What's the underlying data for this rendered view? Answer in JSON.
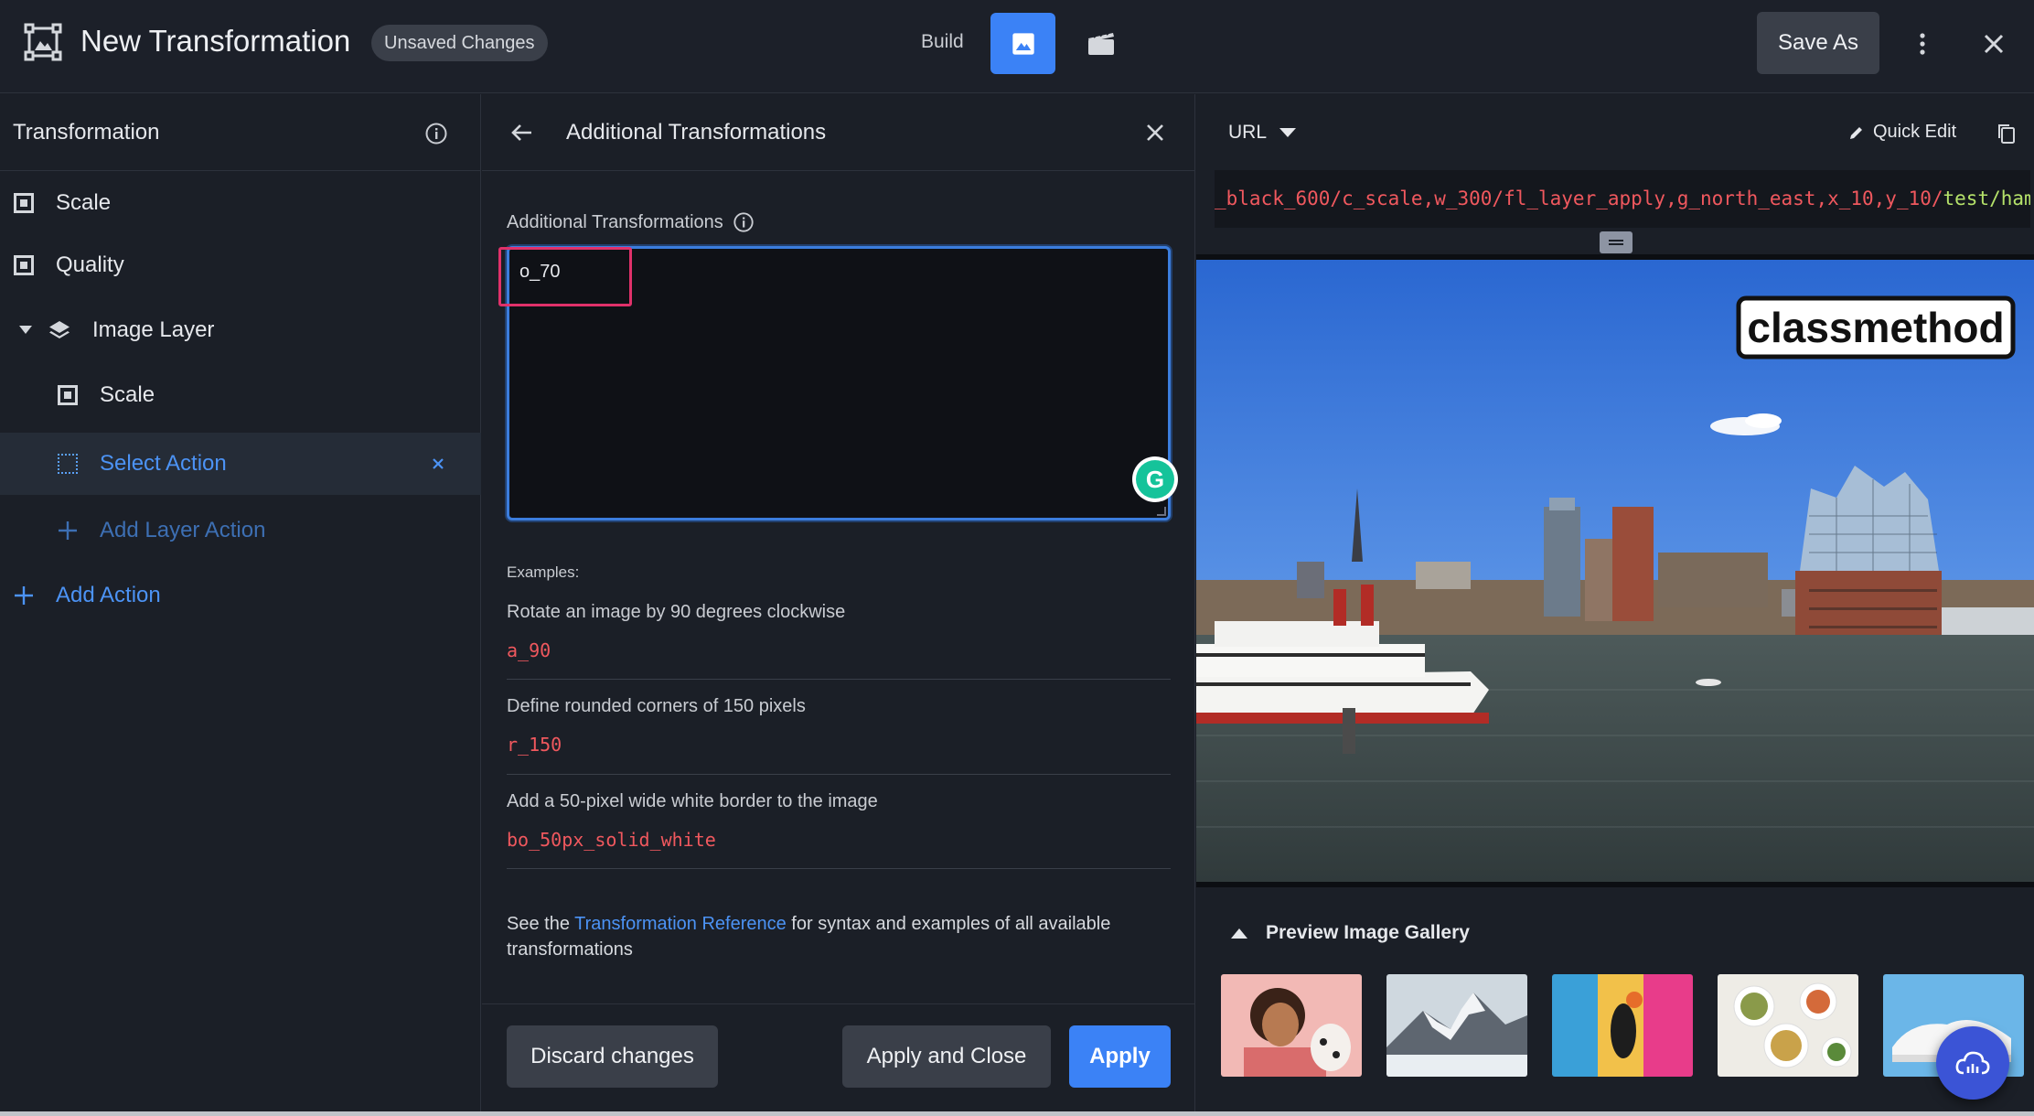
{
  "topbar": {
    "title": "New Transformation",
    "badge": "Unsaved Changes",
    "build_label": "Build",
    "save_as": "Save As"
  },
  "left": {
    "header": "Transformation",
    "items": [
      {
        "label": "Scale"
      },
      {
        "label": "Quality"
      },
      {
        "label": "Image Layer"
      },
      {
        "label": "Scale"
      },
      {
        "label": "Select Action"
      },
      {
        "label": "Add Layer Action"
      },
      {
        "label": "Add Action"
      }
    ]
  },
  "middle": {
    "header": "Additional Transformations",
    "field_label": "Additional Transformations",
    "field_value": "o_70",
    "examples_label": "Examples:",
    "examples": [
      {
        "desc": "Rotate an image by 90 degrees clockwise",
        "code": "a_90"
      },
      {
        "desc": "Define rounded corners of 150 pixels",
        "code": "r_150"
      },
      {
        "desc": "Add a 50-pixel wide white border to the image",
        "code": "bo_50px_solid_white"
      }
    ],
    "ref_prefix": "See the ",
    "ref_link": "Transformation Reference",
    "ref_suffix": " for syntax and examples of all available transformations",
    "buttons": {
      "discard": "Discard changes",
      "apply_close": "Apply and Close",
      "apply": "Apply"
    }
  },
  "right": {
    "url_mode": "URL",
    "quick_edit": "Quick Edit",
    "url_red": "_black_600/c_scale,w_300/fl_layer_apply,g_north_east,x_10,y_10/",
    "url_green": "test/hambu",
    "preview_logo": "classmethod",
    "gallery_title": "Preview Image Gallery"
  },
  "colors": {
    "accent": "#3b82f6",
    "code_red": "#f0585e",
    "code_green": "#b5e26a",
    "highlight": "#e0316a"
  }
}
